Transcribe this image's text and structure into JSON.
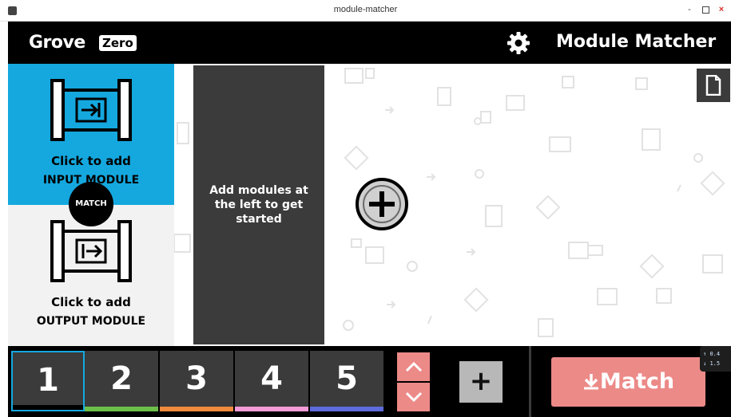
{
  "window": {
    "title": "module-matcher",
    "minimize": "-",
    "close": "×"
  },
  "header": {
    "logo_word": "Grove",
    "logo_badge": "Zero",
    "title": "Module Matcher"
  },
  "left_panel": {
    "input": {
      "line1": "Click to add",
      "line2": "INPUT MODULE"
    },
    "match_badge": "MATCH",
    "output": {
      "line1": "Click to add",
      "line2": "OUTPUT MODULE"
    }
  },
  "canvas": {
    "message": "Add modules at the left to get started"
  },
  "bottom": {
    "tabs": [
      {
        "label": "1",
        "color": "#000000"
      },
      {
        "label": "2",
        "color": "#6cc04a"
      },
      {
        "label": "3",
        "color": "#f08a3c"
      },
      {
        "label": "4",
        "color": "#f59bd8"
      },
      {
        "label": "5",
        "color": "#5e6bdc"
      }
    ],
    "add_label": "+",
    "match_label": "Match",
    "net_up": "0.4",
    "net_down": "1.5"
  },
  "colors": {
    "accent_blue": "#14a8df",
    "match_pink": "#ec8a88",
    "dark_card": "#3b3b3b"
  }
}
